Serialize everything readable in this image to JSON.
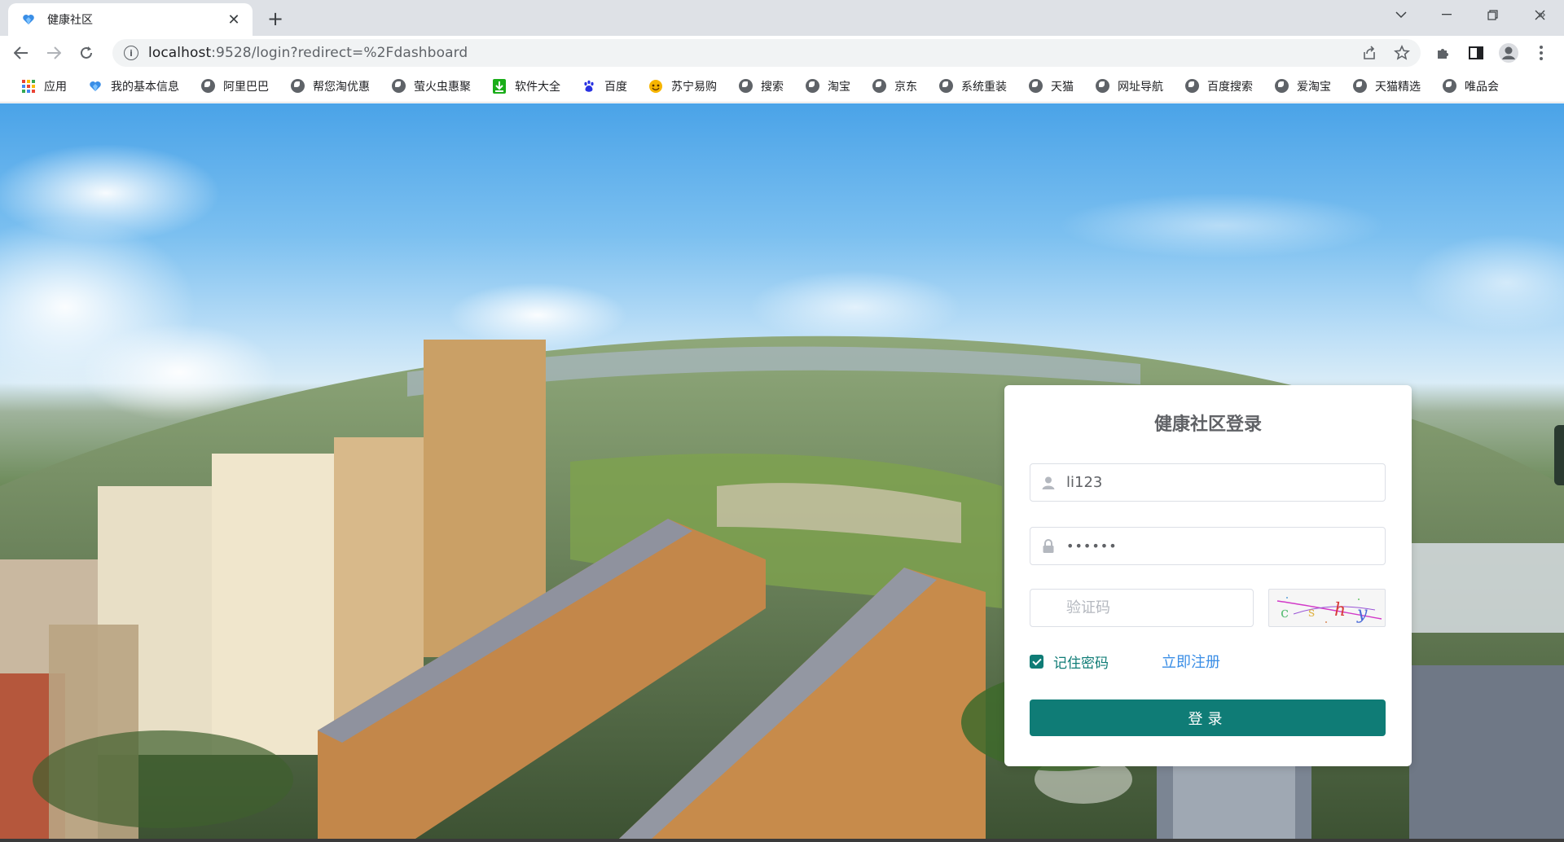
{
  "browser": {
    "tab_title": "健康社区",
    "tab_close": "✕",
    "new_tab": "+",
    "url_host": "localhost",
    "url_rest": ":9528/login?redirect=%2Fdashboard"
  },
  "bookmarks": [
    {
      "label": "应用",
      "icon": "apps-grid-icon"
    },
    {
      "label": "我的基本信息",
      "icon": "heart-shield-icon"
    },
    {
      "label": "阿里巴巴",
      "icon": "globe-icon"
    },
    {
      "label": "帮您淘优惠",
      "icon": "globe-icon"
    },
    {
      "label": "萤火虫惠聚",
      "icon": "globe-icon"
    },
    {
      "label": "软件大全",
      "icon": "download-icon"
    },
    {
      "label": "百度",
      "icon": "baidu-paw-icon"
    },
    {
      "label": "苏宁易购",
      "icon": "suning-icon"
    },
    {
      "label": "搜索",
      "icon": "globe-icon"
    },
    {
      "label": "淘宝",
      "icon": "globe-icon"
    },
    {
      "label": "京东",
      "icon": "globe-icon"
    },
    {
      "label": "系统重装",
      "icon": "globe-icon"
    },
    {
      "label": "天猫",
      "icon": "globe-icon"
    },
    {
      "label": "网址导航",
      "icon": "globe-icon"
    },
    {
      "label": "百度搜索",
      "icon": "globe-icon"
    },
    {
      "label": "爱淘宝",
      "icon": "globe-icon"
    },
    {
      "label": "天猫精选",
      "icon": "globe-icon"
    },
    {
      "label": "唯品会",
      "icon": "globe-icon"
    }
  ],
  "bookmarks_more": "»",
  "login": {
    "title": "健康社区登录",
    "username_value": "li123",
    "password_value": "••••••",
    "captcha_placeholder": "验证码",
    "captcha_text": [
      "c",
      "s",
      "h",
      "y"
    ],
    "remember_label": "记住密码",
    "register_label": "立即注册",
    "submit_label": "登录"
  },
  "colors": {
    "primary": "#0f7c76",
    "link": "#3a8ee6",
    "title": "#606266"
  }
}
